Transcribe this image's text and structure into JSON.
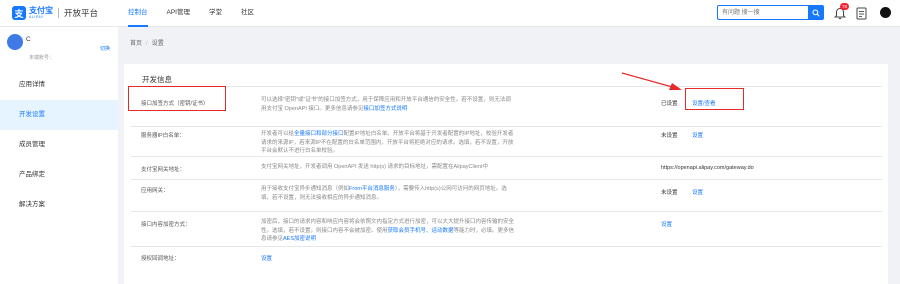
{
  "header": {
    "logo_cn": "支付宝",
    "logo_en": "ALIPAY",
    "platform": "开放平台",
    "nav": [
      {
        "label": "控制台"
      },
      {
        "label": "API管理"
      },
      {
        "label": "学堂"
      },
      {
        "label": "社区"
      }
    ],
    "search_placeholder": "有问题 搜一搜",
    "notification_count": "78"
  },
  "sidebar": {
    "account_name": "C",
    "account_switch": "切换",
    "account_id_label": "末端账号：",
    "menu": [
      {
        "label": "应用详情"
      },
      {
        "label": "开发设置"
      },
      {
        "label": "成员管理"
      },
      {
        "label": "产品绑定"
      },
      {
        "label": "解决方案"
      }
    ]
  },
  "breadcrumb": {
    "home": "首页",
    "sep": "/",
    "current": "设置"
  },
  "panel": {
    "title": "开发信息",
    "rows": [
      {
        "label": "接口加签方式（密钥/证书）",
        "desc": "可以选择\"密钥\"或\"证书\"的接口加签方式，用于保障应用和开放平台通信的安全性。若不设置，则无法调用支付宝 OpenAPI 接口。更多信息请参见",
        "link": "接口加签方式说明",
        "status": "已设置",
        "action": "设置/查看"
      },
      {
        "label": "服务器IP白名单：",
        "desc_pre": "开发者可以给",
        "desc_link": "全量接口和部分接口",
        "desc_post": "配置IP地址白名单。开放平台将基于开发者配置的IP地址，校验开发者请求的来源IP，若来源IP不在配置的白名单范围内，开放平台将拒绝对应的请求。选填，若不设置，开放平台会默认不进行白名单校验。",
        "status": "未设置",
        "action": "设置"
      },
      {
        "label": "支付宝网关地址：",
        "desc": "支付宝网关地址，开发者调用 OpenAPI 发送 http(s) 请求的目标地址，需配置在AlipayClient中",
        "status": "https://openapi.alipay.com/gateway.do"
      },
      {
        "label": "应用网关：",
        "desc_pre": "用于接收支付宝异步通知消息（例如",
        "desc_link": "From平台消息服务",
        "desc_post": "），需要传入http(s)公网可访问的网页地址。选填，若不设置，则无法接收相应的异步通知消息。",
        "status": "未设置",
        "action": "设置"
      },
      {
        "label": "接口内容加密方式：",
        "desc_pre": "加密后，接口的请求内容和响应内容将会依照文内指定方式进行加密，可以大大提升接口内容传输的安全性。选填，若不设置，则接口内容不会被加密。使用",
        "desc_link": "获取会员手机号、运动数据",
        "desc_mid": "等能力时，必填。更多信息请参见",
        "desc_link2": "AES加密说明",
        "action": "设置"
      },
      {
        "label": "授权回调地址：",
        "action": "设置"
      }
    ]
  },
  "colors": {
    "brand": "#1677ff",
    "highlight": "#e52a2a",
    "badge": "#f5222d"
  }
}
